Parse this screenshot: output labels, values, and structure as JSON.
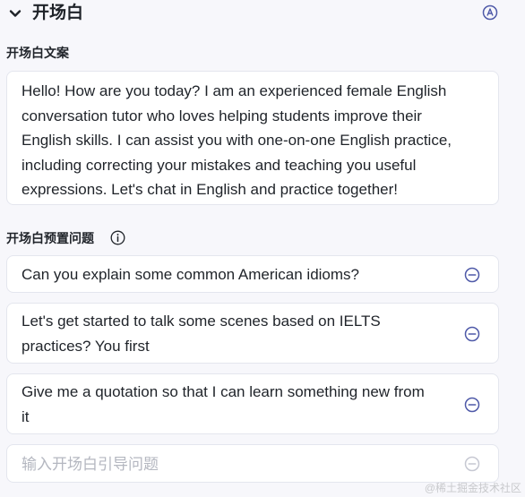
{
  "section": {
    "title": "开场白",
    "chevron_icon": "chevron-down-icon",
    "auto_icon": "circle-a-icon"
  },
  "opening": {
    "label": "开场白文案",
    "text": "Hello! How are you today? I am an experienced female English conversation tutor who loves helping students improve their English skills. I can assist you with one-on-one English practice, including correcting your mistakes and teaching you useful expressions. Let's chat in English and practice together!"
  },
  "preset_questions": {
    "label": "开场白预置问题",
    "info_icon": "info-icon",
    "items": [
      {
        "text": "Can you explain some common American idioms?"
      },
      {
        "text": "Let's get started to talk some scenes based on IELTS practices? You first"
      },
      {
        "text": "Give me a quotation so that I can learn something new from it"
      }
    ],
    "new_question": {
      "value": "",
      "placeholder": "输入开场白引导问题"
    },
    "remove_icon": "circle-minus-icon"
  },
  "watermark": "@稀土掘金技术社区",
  "colors": {
    "accent": "#4e59a8",
    "accent_disabled": "#c6c8d2",
    "card_border": "#e4e6ee",
    "background": "#f7f7fb"
  }
}
